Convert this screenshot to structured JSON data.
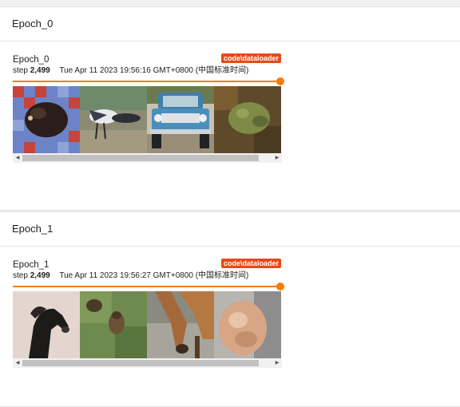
{
  "sections": [
    {
      "header": "Epoch_0",
      "card": {
        "title": "Epoch_0",
        "tag": "code\\dataloader",
        "step_label": "step",
        "step_value": "2,499",
        "timestamp": "Tue Apr 11 2023 19:56:16 GMT+0800 (中国标准时间)",
        "slider_position": 1.0,
        "images": [
          "frog-on-patterned-blanket",
          "bird-on-ground",
          "blue-pickup-truck",
          "frog-on-ground"
        ]
      }
    },
    {
      "header": "Epoch_1",
      "card": {
        "title": "Epoch_1",
        "tag": "code\\dataloader",
        "step_label": "step",
        "step_value": "2,499",
        "timestamp": "Tue Apr 11 2023 19:56:27 GMT+0800 (中国标准时间)",
        "slider_position": 1.0,
        "images": [
          "black-horse",
          "bird-in-grass",
          "deer-grazing",
          "cat-closeup"
        ]
      }
    }
  ],
  "colors": {
    "accent": "#f57c00",
    "tag_bg": "#e64a19"
  }
}
